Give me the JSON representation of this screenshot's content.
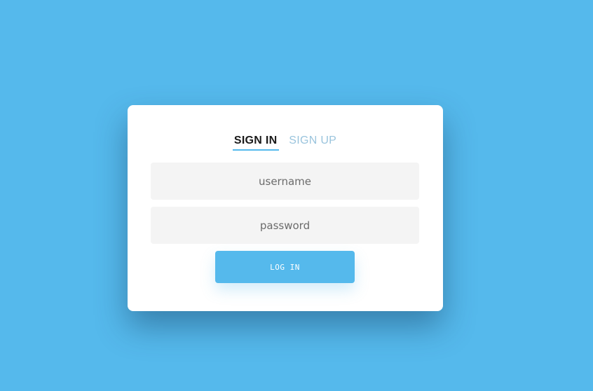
{
  "colors": {
    "background": "#55b9ec",
    "accent": "#55b9ec",
    "card": "#ffffff",
    "field_background": "#f4f4f4",
    "inactive_tab": "#9ac4dd"
  },
  "tabs": [
    {
      "label": "SIGN IN",
      "active": true
    },
    {
      "label": "SIGN UP",
      "active": false
    }
  ],
  "form": {
    "username_placeholder": "username",
    "password_placeholder": "password",
    "submit_label": "LOG IN"
  }
}
